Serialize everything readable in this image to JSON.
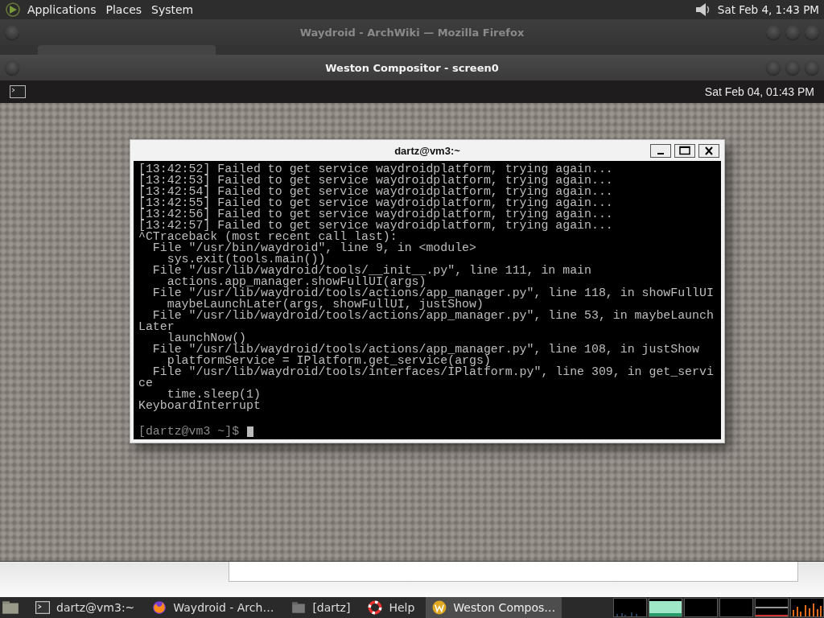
{
  "top_panel": {
    "menus": [
      "Applications",
      "Places",
      "System"
    ],
    "clock": "Sat Feb  4, 1:43 PM"
  },
  "firefox_window": {
    "title": "Waydroid - ArchWiki — Mozilla Firefox"
  },
  "weston_window": {
    "title": "Weston Compositor - screen0",
    "clock": "Sat Feb 04, 01:43 PM"
  },
  "terminal": {
    "title": "dartz@vm3:~",
    "lines": [
      "[13:42:52] Failed to get service waydroidplatform, trying again...",
      "[13:42:53] Failed to get service waydroidplatform, trying again...",
      "[13:42:54] Failed to get service waydroidplatform, trying again...",
      "[13:42:55] Failed to get service waydroidplatform, trying again...",
      "[13:42:56] Failed to get service waydroidplatform, trying again...",
      "[13:42:57] Failed to get service waydroidplatform, trying again...",
      "^CTraceback (most recent call last):",
      "  File \"/usr/bin/waydroid\", line 9, in <module>",
      "    sys.exit(tools.main())",
      "  File \"/usr/lib/waydroid/tools/__init__.py\", line 111, in main",
      "    actions.app_manager.showFullUI(args)",
      "  File \"/usr/lib/waydroid/tools/actions/app_manager.py\", line 118, in showFullUI",
      "    maybeLaunchLater(args, showFullUI, justShow)",
      "  File \"/usr/lib/waydroid/tools/actions/app_manager.py\", line 53, in maybeLaunch",
      "Later",
      "    launchNow()",
      "  File \"/usr/lib/waydroid/tools/actions/app_manager.py\", line 108, in justShow",
      "    platformService = IPlatform.get_service(args)",
      "  File \"/usr/lib/waydroid/tools/interfaces/IPlatform.py\", line 309, in get_servi",
      "ce",
      "    time.sleep(1)",
      "KeyboardInterrupt"
    ],
    "prompt": "[dartz@vm3 ~]$"
  },
  "taskbar": {
    "items": [
      {
        "kind": "terminal",
        "label": "dartz@vm3:~",
        "selected": false
      },
      {
        "kind": "browser",
        "label": "Waydroid - Arch…",
        "selected": false
      },
      {
        "kind": "folder",
        "label": "[dartz]",
        "selected": false
      },
      {
        "kind": "help",
        "label": "Help",
        "selected": false
      },
      {
        "kind": "weston",
        "label": "Weston Compos…",
        "selected": true
      }
    ]
  }
}
